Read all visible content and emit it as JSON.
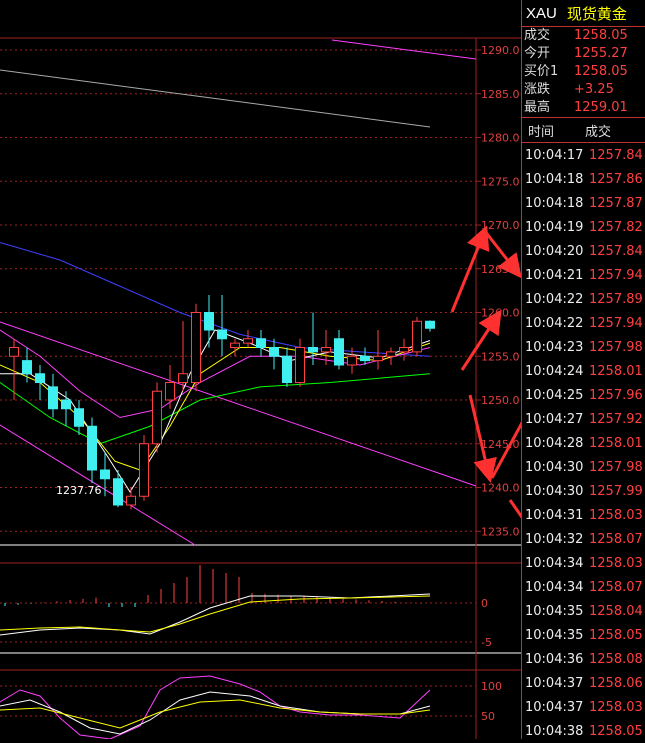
{
  "header": {
    "symbol": "XAU",
    "name": "现货黄金"
  },
  "quote": [
    {
      "label": "成交",
      "value": "1258.05"
    },
    {
      "label": "今开",
      "value": "1255.27"
    },
    {
      "label": "买价1",
      "value": "1258.05"
    },
    {
      "label": "涨跌",
      "value": "+3.25"
    },
    {
      "label": "最高",
      "value": "1259.01"
    }
  ],
  "ticks": {
    "col_time": "时间",
    "col_price": "成交",
    "rows": [
      {
        "t": "10:04:17",
        "p": "1257.84"
      },
      {
        "t": "10:04:18",
        "p": "1257.86"
      },
      {
        "t": "10:04:18",
        "p": "1257.87"
      },
      {
        "t": "10:04:19",
        "p": "1257.82"
      },
      {
        "t": "10:04:20",
        "p": "1257.84"
      },
      {
        "t": "10:04:21",
        "p": "1257.94"
      },
      {
        "t": "10:04:22",
        "p": "1257.89"
      },
      {
        "t": "10:04:22",
        "p": "1257.94"
      },
      {
        "t": "10:04:23",
        "p": "1257.98"
      },
      {
        "t": "10:04:24",
        "p": "1258.01"
      },
      {
        "t": "10:04:25",
        "p": "1257.96"
      },
      {
        "t": "10:04:27",
        "p": "1257.92"
      },
      {
        "t": "10:04:28",
        "p": "1258.01"
      },
      {
        "t": "10:04:30",
        "p": "1257.98"
      },
      {
        "t": "10:04:30",
        "p": "1257.99"
      },
      {
        "t": "10:04:31",
        "p": "1258.03"
      },
      {
        "t": "10:04:32",
        "p": "1258.07"
      },
      {
        "t": "10:04:34",
        "p": "1258.03"
      },
      {
        "t": "10:04:34",
        "p": "1258.07"
      },
      {
        "t": "10:04:35",
        "p": "1258.04"
      },
      {
        "t": "10:04:35",
        "p": "1258.05"
      },
      {
        "t": "10:04:36",
        "p": "1258.08"
      },
      {
        "t": "10:04:37",
        "p": "1258.06"
      },
      {
        "t": "10:04:37",
        "p": "1258.03"
      },
      {
        "t": "10:04:38",
        "p": "1258.05"
      }
    ]
  },
  "main_axis": {
    "labels": [
      "1290.0",
      "1285.0",
      "1280.0",
      "1275.0",
      "1270.0",
      "1265.0",
      "1260.0",
      "1255.0",
      "1250.0",
      "1245.0",
      "1240.0",
      "1235.0"
    ]
  },
  "low_label": "1237.76",
  "macd_axis": {
    "labels": [
      "0",
      "-5"
    ]
  },
  "kdj_axis": {
    "labels": [
      "100",
      "50"
    ]
  },
  "colors": {
    "up": "#ff4040",
    "down": "#40f0f0",
    "grid": "#a02020",
    "ma5": "#ffffff",
    "ma10": "#ffff00",
    "ma20": "#ff40ff",
    "ma60": "#00ff00",
    "ma120": "#4040ff",
    "trend": "#ff40ff"
  }
}
